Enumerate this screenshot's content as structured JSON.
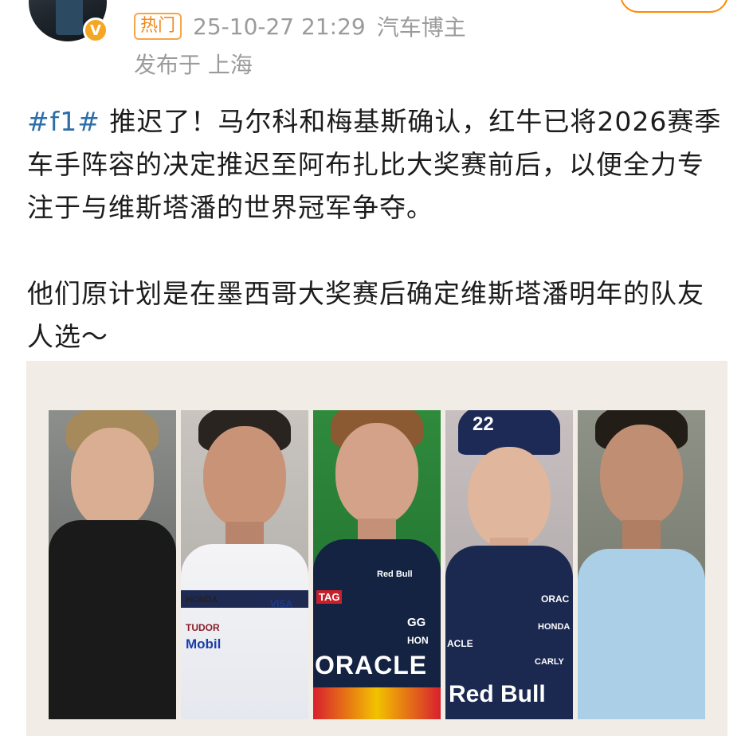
{
  "header": {
    "hot_tag": "热门",
    "timestamp": "25-10-27 21:29",
    "role": "汽车博主",
    "location": "发布于 上海",
    "verified_badge": "V"
  },
  "post": {
    "hashtag": "#f1#",
    "paragraph1": " 推迟了！马尔科和梅基斯确认，红牛已将2026赛季车手阵容的决定推迟至阿布扎比大奖赛前后，以便全力专注于与维斯塔潘的世界冠军争夺。",
    "paragraph2": "他们原计划是在墨西哥大奖赛后确定维斯塔潘明年的队友人选～"
  },
  "image": {
    "background": "#f1ede6",
    "panels": [
      {
        "logos": []
      },
      {
        "logos": [
          "HONDA",
          "VISA",
          "TUDOR",
          "Mobil"
        ]
      },
      {
        "logos": [
          "TAG",
          "Red Bull",
          "ORACLE",
          "GG",
          "HON"
        ]
      },
      {
        "logos": [
          "22",
          "ORAC",
          "HONDA",
          "CARLY",
          "Red Bull",
          "ACLE"
        ]
      },
      {
        "logos": []
      }
    ]
  }
}
